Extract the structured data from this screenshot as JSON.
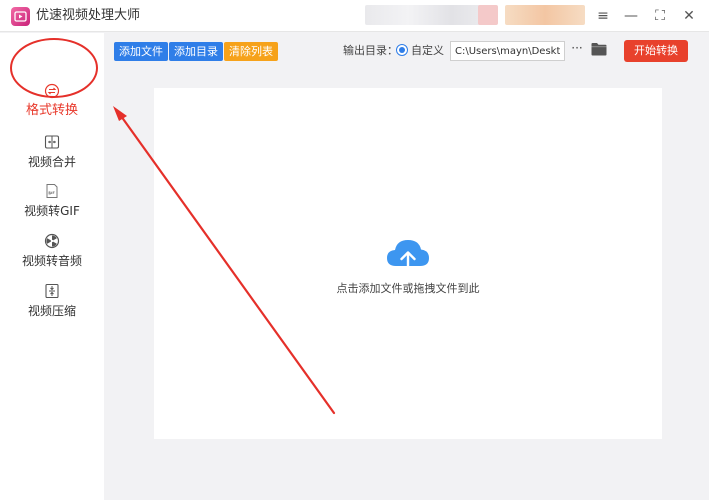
{
  "window": {
    "title": "优速视频处理大师",
    "controls": {
      "menu": "≡",
      "minimize": "—",
      "maximize": "⛶",
      "close": "✕"
    }
  },
  "sidebar": {
    "items": [
      {
        "label": "格式转换",
        "icon": "format-convert-icon",
        "active": true
      },
      {
        "label": "视频合并",
        "icon": "video-merge-icon",
        "active": false
      },
      {
        "label": "视频转GIF",
        "icon": "gif-icon",
        "active": false
      },
      {
        "label": "视频转音频",
        "icon": "audio-icon",
        "active": false
      },
      {
        "label": "视频压缩",
        "icon": "compress-icon",
        "active": false
      }
    ]
  },
  "toolbar": {
    "add_file": "添加文件",
    "add_folder": "添加目录",
    "clear_list": "清除列表",
    "output_label": "输出目录：",
    "custom_option": "自定义",
    "output_path": "C:\\Users\\mayn\\Desktop",
    "more": "···",
    "start": "开始转换"
  },
  "dropzone": {
    "hint": "点击添加文件或拖拽文件到此"
  },
  "colors": {
    "accent_blue": "#2f7ee8",
    "accent_orange": "#f6a21a",
    "start_red": "#e8412c",
    "annotation_red": "#e5302a",
    "upload_blue": "#3d96f0"
  }
}
